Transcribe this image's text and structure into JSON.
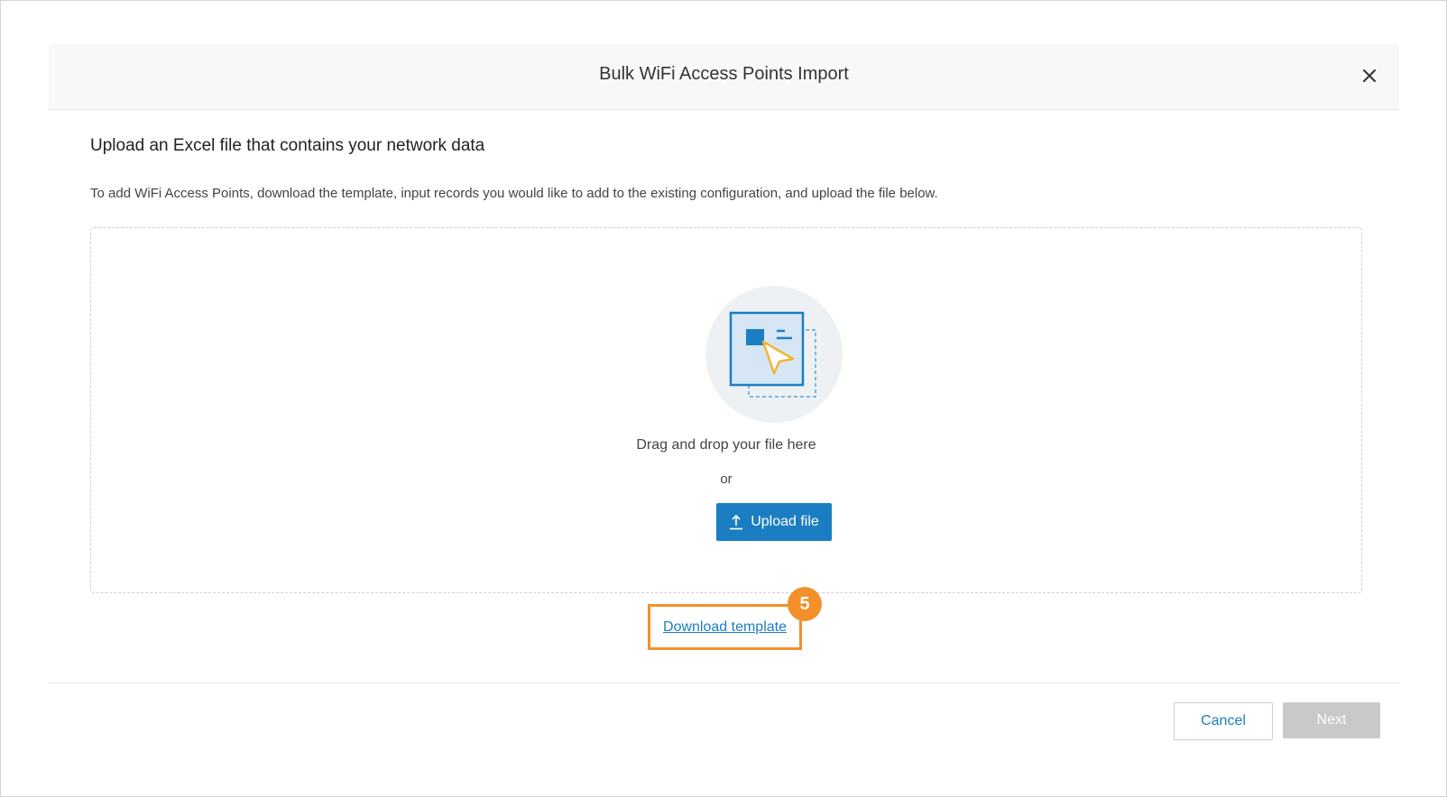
{
  "modal": {
    "title": "Bulk WiFi Access Points Import",
    "close_icon": "close-icon"
  },
  "content": {
    "heading": "Upload an Excel file that contains your network data",
    "instructions": "To add WiFi Access Points, download the template, input records you would like to add to the existing configuration, and upload the file below."
  },
  "dropzone": {
    "illustration_icon": "file-drop-icon",
    "drag_text": "Drag and drop your file here",
    "or_text": "or",
    "upload_label": "Upload file",
    "upload_icon": "upload-icon"
  },
  "download": {
    "link_label": "Download template",
    "step_badge": "5"
  },
  "footer": {
    "cancel_label": "Cancel",
    "next_label": "Next"
  },
  "colors": {
    "primary": "#1b7ec2",
    "highlight": "#f3902b",
    "disabled": "#c9c9c9"
  }
}
